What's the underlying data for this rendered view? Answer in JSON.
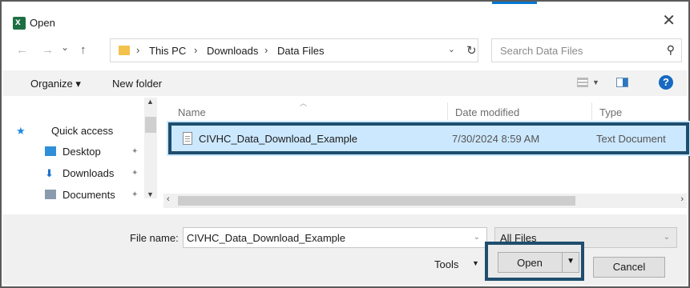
{
  "window": {
    "title": "Open",
    "close_glyph": "✕",
    "accent": "#0078d4"
  },
  "nav_buttons": {
    "back": "←",
    "forward": "→",
    "recent": "⌄",
    "up": "↑"
  },
  "address": {
    "crumbs": [
      "This PC",
      "Downloads",
      "Data Files"
    ],
    "separator": "›",
    "dropdown_glyph": "⌄",
    "refresh_glyph": "↻"
  },
  "search": {
    "placeholder": "Search Data Files",
    "icon": "search-icon"
  },
  "toolbar": {
    "organize": "Organize ▾",
    "new_folder": "New folder",
    "help": "?"
  },
  "sidebar": {
    "items": [
      {
        "label": "Quick access",
        "icon": "star-icon",
        "color": "#1e88e5"
      },
      {
        "label": "Desktop",
        "icon": "desktop-icon",
        "color": "#2f8fd8"
      },
      {
        "label": "Downloads",
        "icon": "download-icon",
        "color": "#1f6fc9"
      },
      {
        "label": "Documents",
        "icon": "documents-icon",
        "color": "#8a9bb0"
      }
    ],
    "pin_glyph": "📌"
  },
  "file_list": {
    "columns": [
      "Name",
      "Date modified",
      "Type"
    ],
    "rows": [
      {
        "name": "CIVHC_Data_Download_Example",
        "date": "7/30/2024 8:59 AM",
        "type": "Text Document"
      }
    ],
    "selected_color": "#cce8ff",
    "highlight_color": "#1f4e6e"
  },
  "bottom": {
    "file_name_label": "File name:",
    "file_name_value": "CIVHC_Data_Download_Example",
    "filter_value": "All Files",
    "tools_label": "Tools",
    "open_label": "Open",
    "cancel_label": "Cancel"
  }
}
